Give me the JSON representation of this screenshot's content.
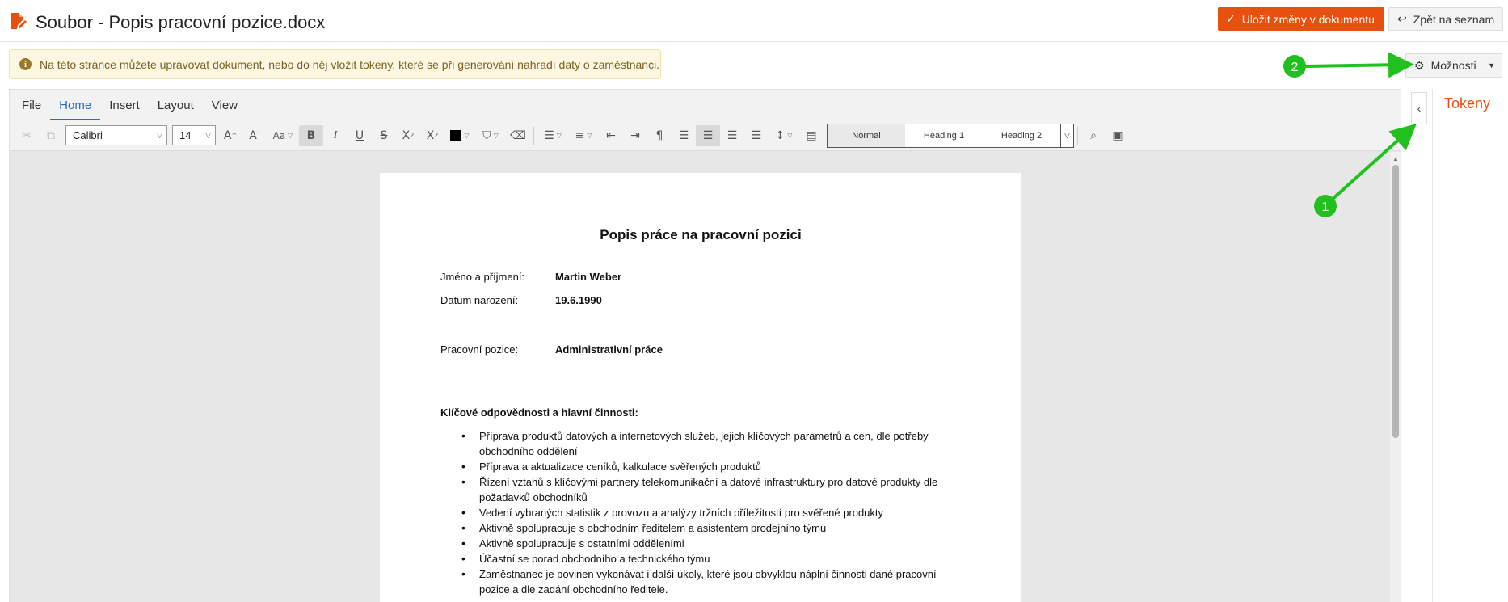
{
  "header": {
    "title": "Soubor - Popis pracovní pozice.docx",
    "save_label": "Uložit změny v dokumentu",
    "back_label": "Zpět na seznam"
  },
  "notice": {
    "text": "Na této stránce můžete upravovat dokument, nebo do něj vložit tokeny, které se při generování nahradí daty o zaměstnanci."
  },
  "options_label": "Možnosti",
  "ribbon": {
    "tabs": [
      "File",
      "Home",
      "Insert",
      "Layout",
      "View"
    ],
    "active_tab": "Home",
    "font_name": "Calibri",
    "font_size": "14",
    "change_case": "Aa",
    "styles": [
      "Normal",
      "Heading 1",
      "Heading 2"
    ]
  },
  "document": {
    "title": "Popis práce na pracovní pozici",
    "fields": [
      {
        "label": "Jméno a příjmení:",
        "value": "Martin Weber"
      },
      {
        "label": "Datum narození:",
        "value": "19.6.1990"
      },
      {
        "label": "Pracovní pozice:",
        "value": "Administrativní práce"
      }
    ],
    "section_heading": "Klíčové odpovědnosti a hlavní činnosti:",
    "duties": [
      "Příprava produktů datových a internetových služeb, jejich klíčových parametrů a cen, dle potřeby obchodního oddělení",
      "Příprava a aktualizace ceníků, kalkulace svěřených produktů",
      "Řízení vztahů s klíčovými partnery telekomunikační a datové infrastruktury pro datové produkty dle požadavků obchodníků",
      "Vedení vybraných statistik z provozu a analýzy tržních příležitostí pro svěřené produkty",
      "Aktivně spolupracuje s obchodním ředitelem a asistentem prodejního týmu",
      "Aktivně spolupracuje s ostatními odděleními",
      "Účastní se porad obchodního a technického týmu",
      "Zaměstnanec je povinen vykonávat i další úkoly, které jsou obvyklou náplní činnosti dané pracovní pozice a dle zadání obchodního ředitele."
    ]
  },
  "side_panel": {
    "title": "Tokeny"
  },
  "annotations": {
    "badge_1": "1",
    "badge_2": "2",
    "color": "#22c01e"
  },
  "colors": {
    "accent": "#e8500f",
    "ribbon_active": "#2a6cc4"
  }
}
